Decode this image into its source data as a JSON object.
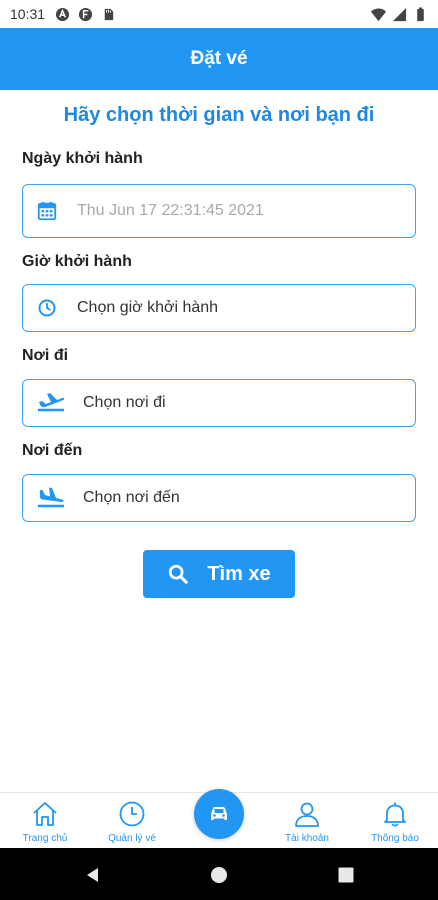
{
  "status_bar": {
    "time": "10:31"
  },
  "app_bar": {
    "title": "Đặt vé"
  },
  "subtitle": "Hãy chọn thời gian và nơi bạn đi",
  "form": {
    "departure_date": {
      "label": "Ngày khởi hành",
      "placeholder": "Thu Jun 17 22:31:45 2021"
    },
    "departure_time": {
      "label": "Giờ khởi hành",
      "value": "Chọn giờ khởi hành"
    },
    "origin": {
      "label": "Nơi đi",
      "value": "Chọn nơi đi"
    },
    "destination": {
      "label": "Nơi đến",
      "value": "Chọn nơi đến"
    }
  },
  "search_button": {
    "label": "Tìm xe"
  },
  "bottom_nav": {
    "items": [
      {
        "label": "Trang chủ",
        "icon": "home-icon"
      },
      {
        "label": "Quản lý vé",
        "icon": "clock-icon"
      },
      {
        "label": "",
        "icon": "car-icon"
      },
      {
        "label": "Tài khoản",
        "icon": "user-icon"
      },
      {
        "label": "Thông báo",
        "icon": "bell-icon"
      }
    ]
  },
  "colors": {
    "primary": "#2196f3",
    "subtitle": "#1e88e5",
    "field_border": "#3ea2ef"
  }
}
